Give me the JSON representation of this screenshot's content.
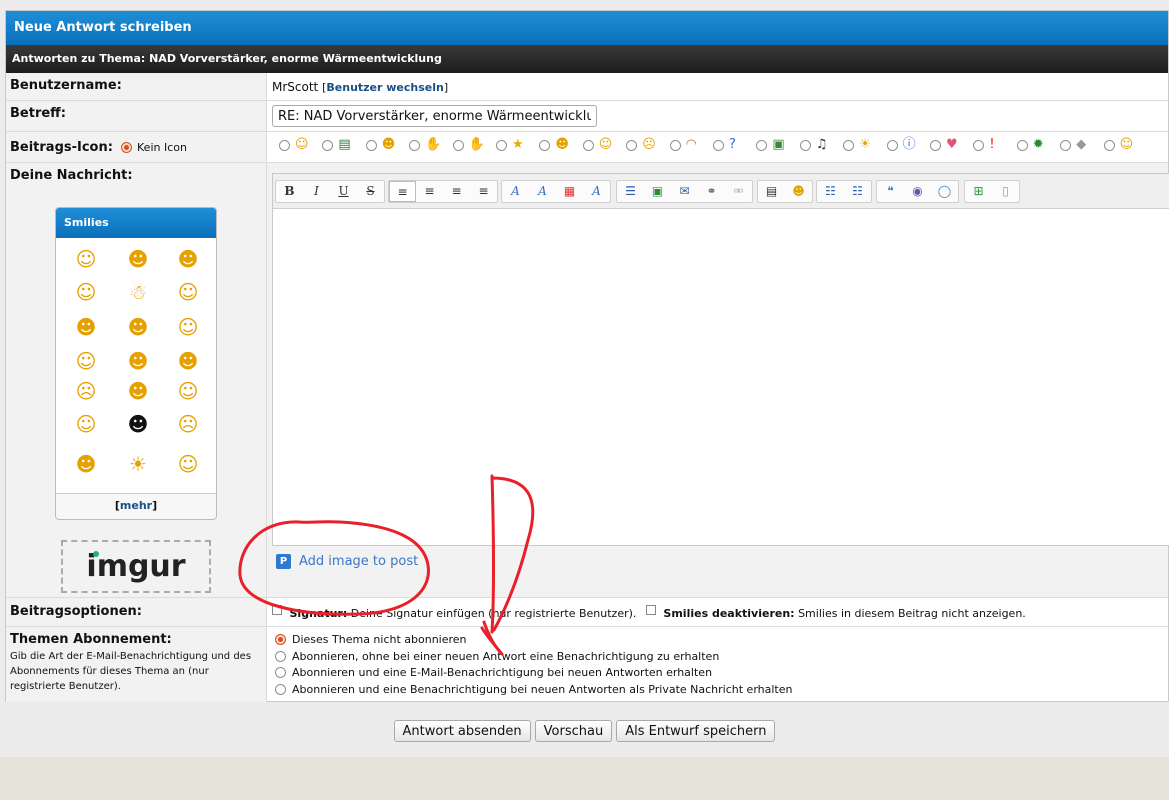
{
  "header": {
    "title": "Neue Antwort schreiben",
    "subtitle": "Antworten zu Thema: NAD Vorverstärker, enorme Wärmeentwicklung"
  },
  "username": {
    "label": "Benutzername:",
    "value": "MrScott",
    "switch_link": "Benutzer wechseln"
  },
  "subject": {
    "label": "Betreff:",
    "value": "RE: NAD Vorverstärker, enorme Wärmeentwicklung"
  },
  "post_icon": {
    "label": "Beitrags-Icon:",
    "none_label": "Kein Icon",
    "icons": [
      "smile-icon",
      "film-icon",
      "wink-icon",
      "hand-icon",
      "thumb-down-icon",
      "star-icon",
      "grin-icon",
      "cool-icon",
      "sad-icon",
      "rainbow-icon",
      "question-icon",
      "picture-icon",
      "music-icon",
      "lightbulb-icon",
      "info-icon",
      "heart-icon",
      "exclamation-icon",
      "bug-icon",
      "cube-icon",
      "laugh-icon"
    ]
  },
  "message": {
    "label": "Deine Nachricht:"
  },
  "smilies": {
    "title": "Smilies",
    "more_open": "[",
    "more_link": "mehr",
    "more_close": "]"
  },
  "imgur": {
    "logo": "imgur",
    "add_image": "Add image to post"
  },
  "options": {
    "label": "Beitragsoptionen:",
    "signature_bold": "Signatur:",
    "signature_text": "Deine Signatur einfügen (nur registrierte Benutzer).",
    "smilies_bold": "Smilies deaktivieren:",
    "smilies_text": "Smilies in diesem Beitrag nicht anzeigen."
  },
  "subscription": {
    "label": "Themen Abonnement:",
    "desc": "Gib die Art der E-Mail-Benachrichtigung und des Abonnements für dieses Thema an (nur registrierte Benutzer).",
    "choices": [
      "Dieses Thema nicht abonnieren",
      "Abonnieren, ohne bei einer neuen Antwort eine Benachrichtigung zu erhalten",
      "Abonnieren und eine E-Mail-Benachrichtigung bei neuen Antworten erhalten",
      "Abonnieren und eine Benachrichtigung bei neuen Antworten als Private Nachricht erhalten"
    ]
  },
  "buttons": {
    "submit": "Antwort absenden",
    "preview": "Vorschau",
    "draft": "Als Entwurf speichern"
  },
  "colors": {
    "header_blue": "#0b6fb9",
    "annotation_red": "#e8202a"
  }
}
